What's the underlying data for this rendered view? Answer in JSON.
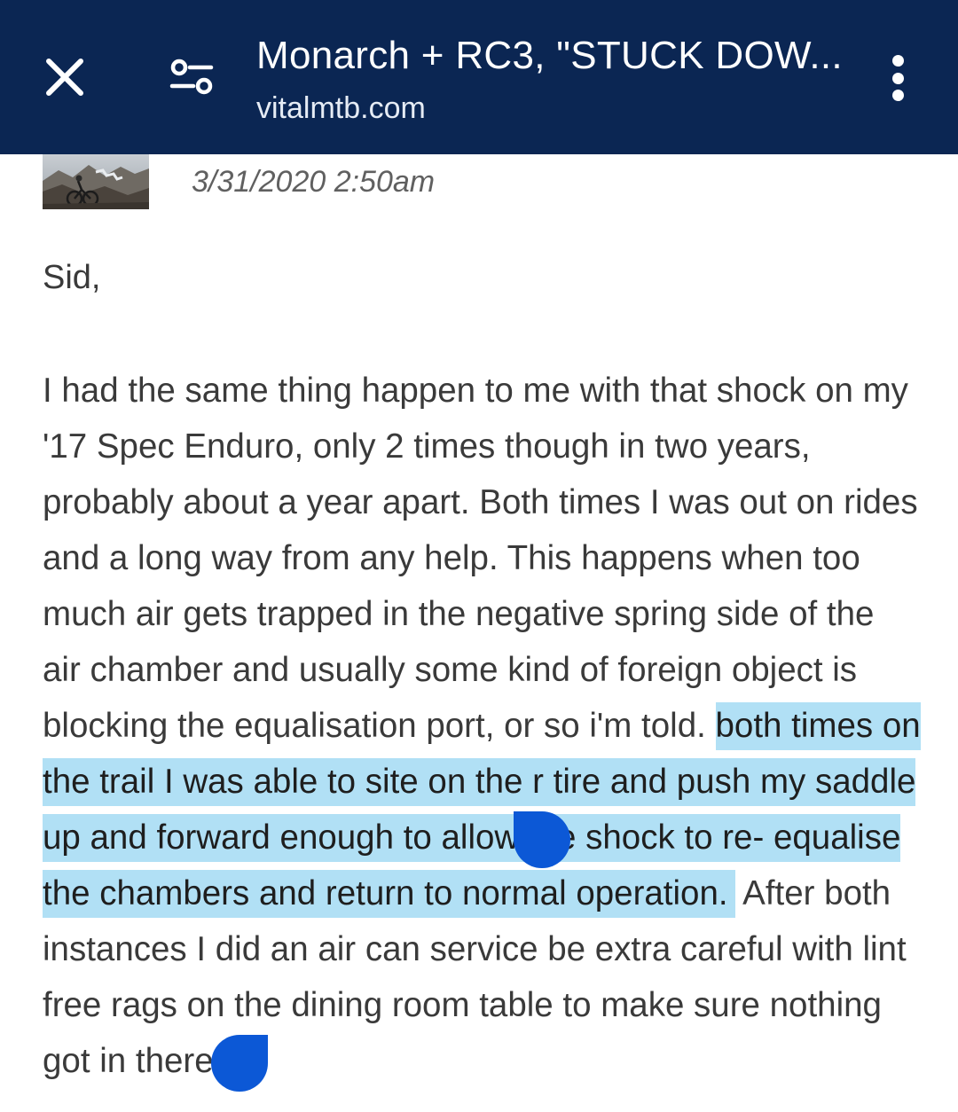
{
  "toolbar": {
    "title": "Monarch + RC3, \"STUCK DOW...",
    "url": "vitalmtb.com",
    "background_color": "#0b2653",
    "close_icon": "close-icon",
    "tune_icon": "page-settings-icon",
    "menu_icon": "more-vertical-icon"
  },
  "post": {
    "timestamp": "3/31/2020 2:50am",
    "greeting": "Sid,",
    "body_before_selection": "I had the same thing happen to me with that shock on my '17 Spec Enduro, only 2 times though in two years, probably about a year apart. Both times I was out on rides and a long way from any help. This happens when too much air gets trapped in the negative spring side of the air chamber and usually some kind of foreign object is blocking the equalisation port, or so i'm told. ",
    "selected_text": "both times on the trail I was able to site on the  r tire and push my saddle up and forward enough to allow the shock to re- equalise the chambers and return to normal operation.",
    "body_after_selection": " After both instances I did an air can service be  extra careful with lint free rags on the dining room table to make sure nothing got in there",
    "selection_color": "#b1e0f5",
    "selection_handle_color": "#0c58d6"
  }
}
